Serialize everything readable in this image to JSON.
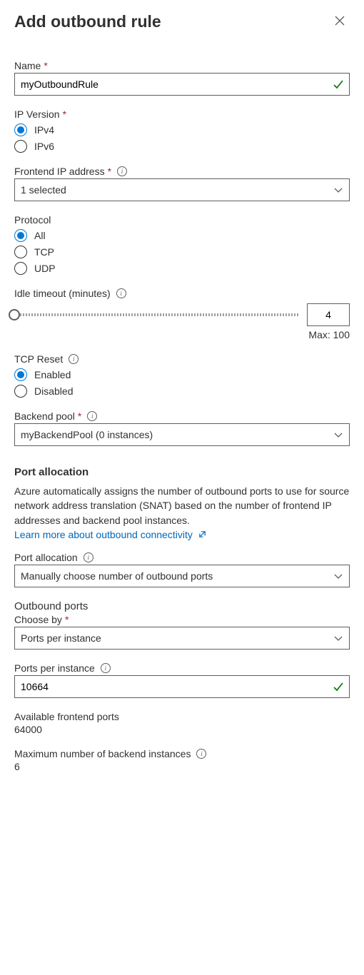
{
  "title": "Add outbound rule",
  "name": {
    "label": "Name",
    "value": "myOutboundRule"
  },
  "ipversion": {
    "label": "IP Version",
    "options": {
      "ipv4": "IPv4",
      "ipv6": "IPv6"
    },
    "selected": "ipv4"
  },
  "frontend": {
    "label": "Frontend IP address",
    "value": "1 selected"
  },
  "protocol": {
    "label": "Protocol",
    "options": {
      "all": "All",
      "tcp": "TCP",
      "udp": "UDP"
    },
    "selected": "all"
  },
  "idle": {
    "label": "Idle timeout (minutes)",
    "value": "4",
    "max_label": "Max: 100"
  },
  "tcpreset": {
    "label": "TCP Reset",
    "options": {
      "enabled": "Enabled",
      "disabled": "Disabled"
    },
    "selected": "enabled"
  },
  "backendpool": {
    "label": "Backend pool",
    "value": "myBackendPool (0 instances)"
  },
  "portalloc": {
    "section_title": "Port allocation",
    "description": "Azure automatically assigns the number of outbound ports to use for source network address translation (SNAT) based on the number of frontend IP addresses and backend pool instances.",
    "link_text": "Learn more about outbound connectivity",
    "label": "Port allocation",
    "value": "Manually choose number of outbound ports"
  },
  "outbound": {
    "section_title": "Outbound ports",
    "chooseby_label": "Choose by",
    "chooseby_value": "Ports per instance",
    "ppi_label": "Ports per instance",
    "ppi_value": "10664",
    "avail_label": "Available frontend ports",
    "avail_value": "64000",
    "max_label": "Maximum number of backend instances",
    "max_value": "6"
  }
}
